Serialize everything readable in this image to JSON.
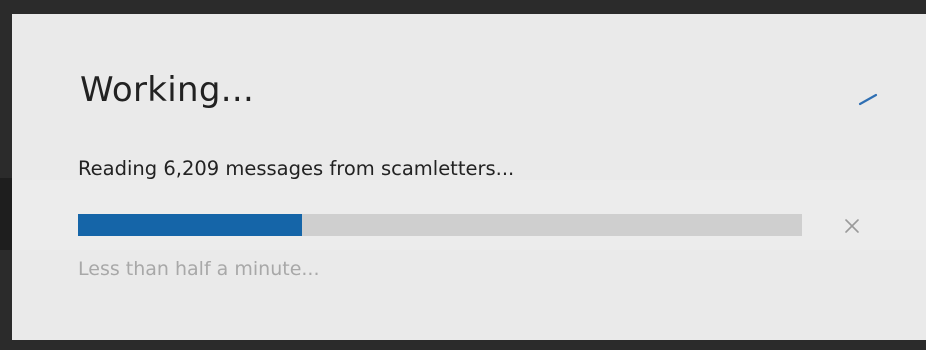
{
  "dialog": {
    "title": "Working...",
    "message": "Reading 6,209 messages from scamletters...",
    "eta": "Less than half a minute...",
    "progress": 0.31,
    "icons": {
      "spinner": "spinner-icon",
      "cancel": "close-icon"
    },
    "colors": {
      "accent": "#1565a8",
      "track": "#cfcfcf",
      "background": "#eaeaea"
    }
  }
}
